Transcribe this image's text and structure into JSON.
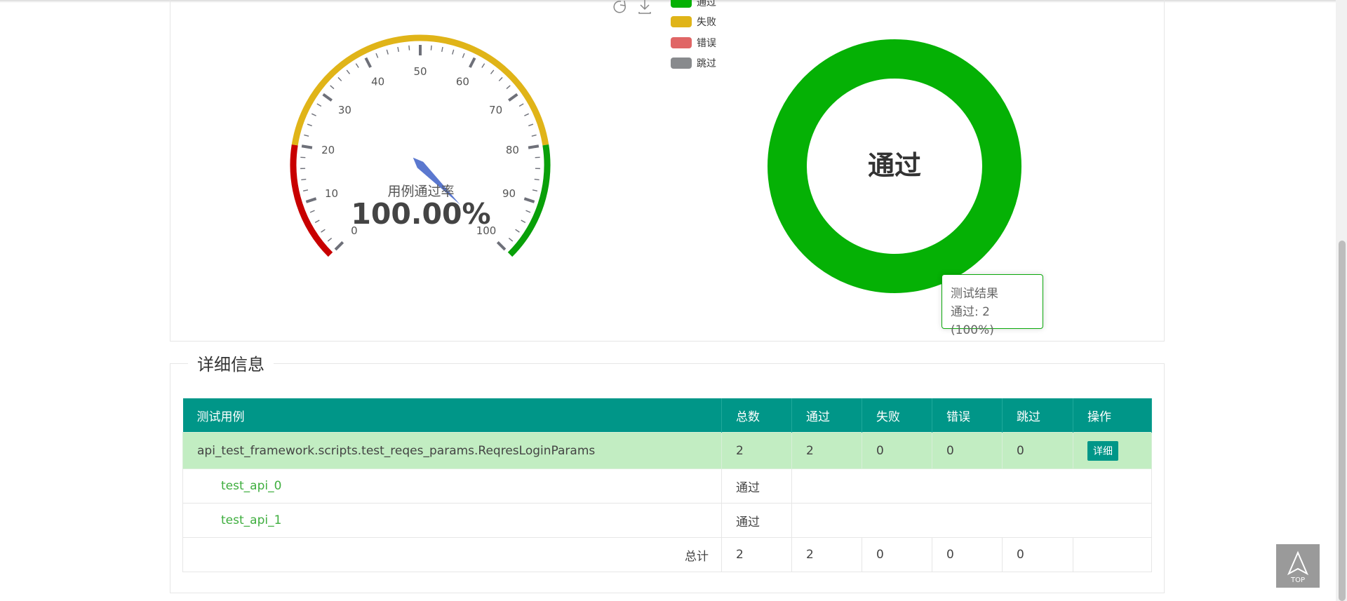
{
  "gauge": {
    "title": "用例通过率",
    "value_text": "100.00%",
    "value": 100,
    "ticks": [
      "0",
      "10",
      "20",
      "30",
      "40",
      "50",
      "60",
      "70",
      "80",
      "90",
      "100"
    ],
    "colors": {
      "low": "#c80000",
      "mid": "#e0b418",
      "high": "#09a009",
      "needle": "#5b78cf"
    }
  },
  "donut": {
    "center_label": "通过",
    "color": "#05b105"
  },
  "legend": {
    "items": [
      {
        "label": "通过",
        "color": "#05b105"
      },
      {
        "label": "失败",
        "color": "#e0b418"
      },
      {
        "label": "错误",
        "color": "#e06666"
      },
      {
        "label": "跳过",
        "color": "#888a8d"
      }
    ]
  },
  "toolbox": {
    "icons": [
      "refresh-icon",
      "download-icon"
    ]
  },
  "tooltip": {
    "title": "测试结果",
    "line": "通过: 2 (100%)"
  },
  "detail": {
    "title": "详细信息",
    "headers": [
      "测试用例",
      "总数",
      "通过",
      "失败",
      "错误",
      "跳过",
      "操作"
    ],
    "suite": {
      "name": "api_test_framework.scripts.test_reqes_params.ReqresLoginParams",
      "total": "2",
      "passed": "2",
      "failed": "0",
      "error": "0",
      "skipped": "0",
      "action": "详细"
    },
    "cases": [
      {
        "name": "test_api_0",
        "status": "通过"
      },
      {
        "name": "test_api_1",
        "status": "通过"
      }
    ],
    "totals": {
      "label": "总计",
      "total": "2",
      "passed": "2",
      "failed": "0",
      "error": "0",
      "skipped": "0"
    }
  },
  "top_button": {
    "label": "TOP"
  }
}
